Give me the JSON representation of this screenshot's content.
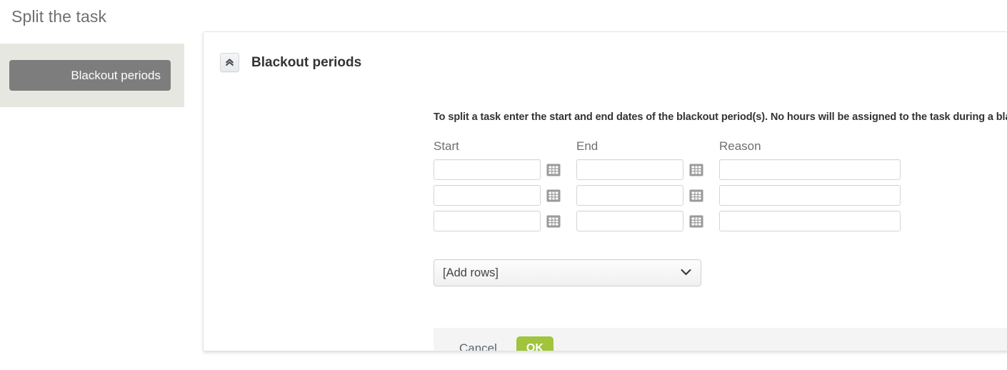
{
  "page": {
    "title": "Split the task"
  },
  "sidebar": {
    "items": [
      {
        "label": "Blackout periods",
        "active": true
      }
    ]
  },
  "panel": {
    "collapse_icon": "double-chevron-up-icon",
    "title": "Blackout periods",
    "description": "To split a task enter the start and end dates of the blackout period(s). No hours will be assigned to the task during a blackout period.",
    "columns": [
      "Start",
      "End",
      "Reason"
    ],
    "rows": [
      {
        "start": "",
        "end": "",
        "reason": "",
        "start_picker_icon": "calendar-icon",
        "end_picker_icon": "calendar-icon"
      },
      {
        "start": "",
        "end": "",
        "reason": "",
        "start_picker_icon": "calendar-icon",
        "end_picker_icon": "calendar-icon"
      },
      {
        "start": "",
        "end": "",
        "reason": "",
        "start_picker_icon": "calendar-icon",
        "end_picker_icon": "calendar-icon"
      }
    ],
    "add_rows": {
      "selected": "[Add rows]",
      "options": [
        "[Add rows]"
      ],
      "chevron_icon": "chevron-down-icon"
    },
    "footer": {
      "cancel_label": "Cancel",
      "ok_label": "OK"
    }
  },
  "colors": {
    "accent_green": "#a0c43c",
    "sidebar_active": "#7d7d7d",
    "sidebar_bg": "#e7e7e1",
    "footer_bg": "#f4f4f4",
    "title_text": "#6f6f6f"
  }
}
